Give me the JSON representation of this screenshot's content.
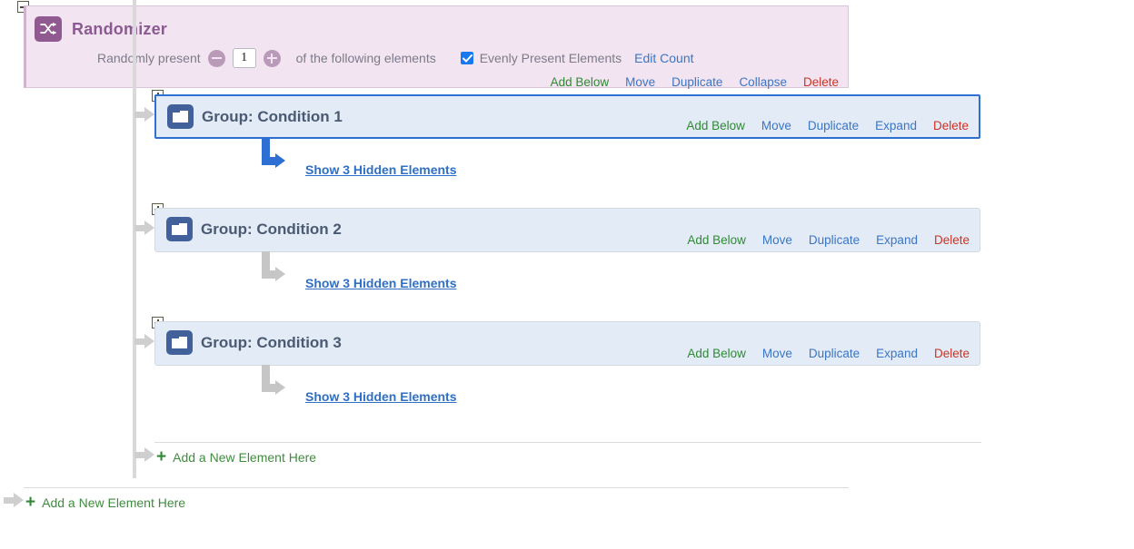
{
  "randomizer": {
    "title": "Randomizer",
    "icon": "shuffle-icon",
    "collapse_toggle": "minus-box",
    "present_prefix": "Randomly present",
    "decrement_label": "−",
    "count_value": "1",
    "increment_label": "+",
    "present_suffix": "of the following elements",
    "evenly_present_label": "Evenly Present Elements",
    "evenly_present_checked": true,
    "edit_count_label": "Edit Count",
    "actions": [
      {
        "label": "Add Below",
        "kind": "add"
      },
      {
        "label": "Move",
        "kind": "blue"
      },
      {
        "label": "Duplicate",
        "kind": "blue"
      },
      {
        "label": "Collapse",
        "kind": "blue"
      },
      {
        "label": "Delete",
        "kind": "delete"
      }
    ]
  },
  "groups": [
    {
      "expand_toggle": "plus-box",
      "icon": "group-folder-icon",
      "title": "Group: Condition 1",
      "selected": true,
      "connector_color": "#2e6fd4",
      "hidden_link": "Show 3 Hidden Elements",
      "actions": [
        {
          "label": "Add Below",
          "kind": "add"
        },
        {
          "label": "Move",
          "kind": "blue"
        },
        {
          "label": "Duplicate",
          "kind": "blue"
        },
        {
          "label": "Expand",
          "kind": "blue"
        },
        {
          "label": "Delete",
          "kind": "delete"
        }
      ]
    },
    {
      "expand_toggle": "plus-box",
      "icon": "group-folder-icon",
      "title": "Group: Condition 2",
      "selected": false,
      "connector_color": "#c6c6c6",
      "hidden_link": "Show 3 Hidden Elements",
      "actions": [
        {
          "label": "Add Below",
          "kind": "add"
        },
        {
          "label": "Move",
          "kind": "blue"
        },
        {
          "label": "Duplicate",
          "kind": "blue"
        },
        {
          "label": "Expand",
          "kind": "blue"
        },
        {
          "label": "Delete",
          "kind": "delete"
        }
      ]
    },
    {
      "expand_toggle": "plus-box",
      "icon": "group-folder-icon",
      "title": "Group: Condition 3",
      "selected": false,
      "connector_color": "#c6c6c6",
      "hidden_link": "Show 3 Hidden Elements",
      "actions": [
        {
          "label": "Add Below",
          "kind": "add"
        },
        {
          "label": "Move",
          "kind": "blue"
        },
        {
          "label": "Duplicate",
          "kind": "blue"
        },
        {
          "label": "Expand",
          "kind": "blue"
        },
        {
          "label": "Delete",
          "kind": "delete"
        }
      ]
    }
  ],
  "add_rows": [
    {
      "plus": "+",
      "label": "Add a New Element Here"
    },
    {
      "plus": "+",
      "label": "Add a New Element Here"
    }
  ],
  "colors": {
    "randomizer_bg": "#f3e4f1",
    "randomizer_accent": "#90598f",
    "group_bg": "#e3ebf7",
    "group_icon": "#42619a",
    "selected_border": "#2e6fd4",
    "link_blue": "#3a76c4",
    "add_green": "#2f8a33",
    "delete_red": "#cc3322",
    "checkbox_blue": "#1878f0",
    "guide_gray": "#d9d9d9"
  }
}
